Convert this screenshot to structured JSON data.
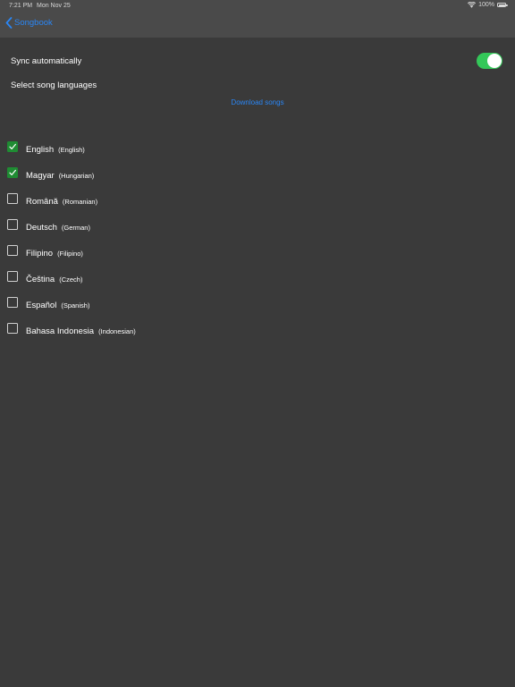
{
  "status_bar": {
    "time": "7:21 PM",
    "date": "Mon Nov 25",
    "battery": "100%"
  },
  "nav": {
    "back_label": "Songbook"
  },
  "settings": {
    "sync_label": "Sync automatically",
    "sync_enabled": true,
    "languages_label": "Select song languages",
    "download_label": "Download songs"
  },
  "languages": [
    {
      "name": "English",
      "english_name": "(English)",
      "checked": true
    },
    {
      "name": "Magyar",
      "english_name": "(Hungarian)",
      "checked": true
    },
    {
      "name": "Română",
      "english_name": "(Romanian)",
      "checked": false
    },
    {
      "name": "Deutsch",
      "english_name": "(German)",
      "checked": false
    },
    {
      "name": "Filipino",
      "english_name": "(Filipino)",
      "checked": false
    },
    {
      "name": "Čeština",
      "english_name": "(Czech)",
      "checked": false
    },
    {
      "name": "Español",
      "english_name": "(Spanish)",
      "checked": false
    },
    {
      "name": "Bahasa Indonesia",
      "english_name": "(Indonesian)",
      "checked": false
    }
  ],
  "colors": {
    "accent": "#2a86f5",
    "toggle_on": "#34c759",
    "checkbox_checked": "#1f8c33",
    "background": "#3a3a3a",
    "bar_background": "#4a4a4a"
  },
  "icons": {
    "back": "chevron-left-icon",
    "wifi": "wifi-icon",
    "battery": "battery-icon",
    "check": "checkmark-icon"
  }
}
